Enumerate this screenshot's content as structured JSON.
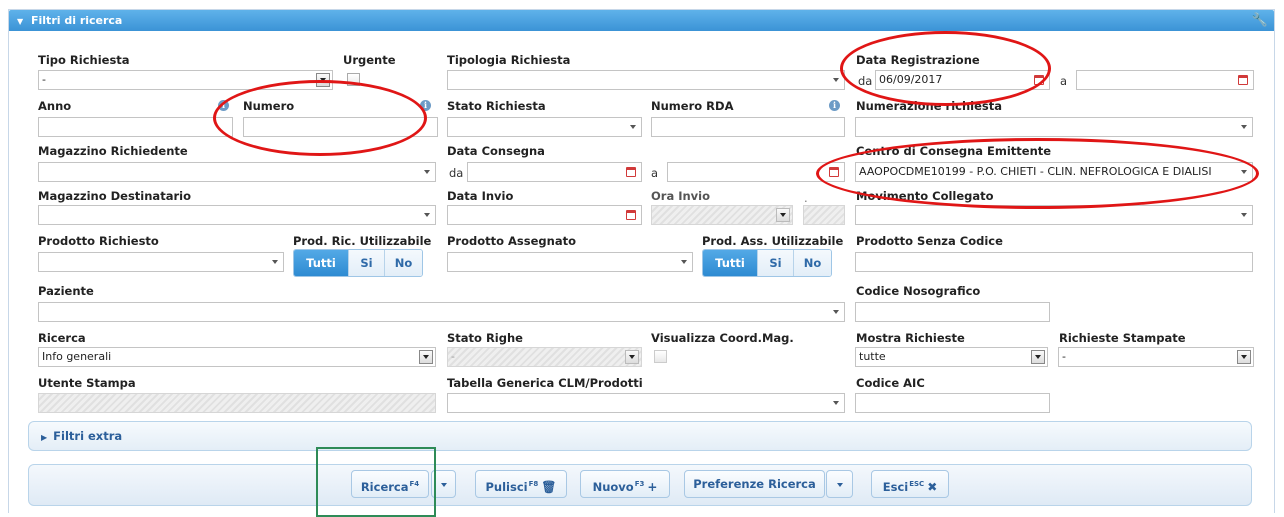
{
  "panel": {
    "title": "Filtri di ricerca"
  },
  "labels": {
    "tipo_richiesta": "Tipo Richiesta",
    "urgente": "Urgente",
    "tipologia_richiesta": "Tipologia Richiesta",
    "data_registrazione": "Data Registrazione",
    "anno": "Anno",
    "numero": "Numero",
    "stato_richiesta": "Stato Richiesta",
    "numero_rda": "Numero RDA",
    "numerazione_richiesta": "Numerazione richiesta",
    "magazzino_richiedente": "Magazzino Richiedente",
    "data_consegna": "Data Consegna",
    "centro_consegna": "Centro di Consegna Emittente",
    "magazzino_destinatario": "Magazzino Destinatario",
    "data_invio": "Data Invio",
    "ora_invio": "Ora Invio",
    "ora_sep": ".",
    "movimento_collegato": "Movimento Collegato",
    "prodotto_richiesto": "Prodotto Richiesto",
    "prod_ric_utilizzabile": "Prod. Ric. Utilizzabile",
    "prodotto_assegnato": "Prodotto Assegnato",
    "prod_ass_utilizzabile": "Prod. Ass. Utilizzabile",
    "prodotto_senza_codice": "Prodotto Senza Codice",
    "paziente": "Paziente",
    "codice_nosografico": "Codice Nosografico",
    "ricerca": "Ricerca",
    "stato_righe": "Stato Righe",
    "visualizza_coord": "Visualizza Coord.Mag.",
    "mostra_richieste": "Mostra Richieste",
    "richieste_stampate": "Richieste Stampate",
    "utente_stampa": "Utente Stampa",
    "tabella_generica": "Tabella Generica CLM/Prodotti",
    "codice_aic": "Codice AIC",
    "da": "da",
    "a": "a"
  },
  "values": {
    "tipo_richiesta": "-",
    "data_registrazione_da": "06/09/2017",
    "centro_consegna": "AAOPOCDME10199 - P.O. CHIETI - CLIN. NEFROLOGICA E DIALISI",
    "ricerca": "Info generali",
    "stato_righe": "-",
    "mostra_richieste": "tutte",
    "richieste_stampate": "-"
  },
  "toggles": {
    "tutti": "Tutti",
    "si": "Si",
    "no": "No"
  },
  "filtri_extra": "Filtri extra",
  "buttons": {
    "ricerca": "Ricerca",
    "ricerca_key": "F4",
    "pulisci": "Pulisci",
    "pulisci_key": "F8",
    "nuovo": "Nuovo",
    "nuovo_key": "F3",
    "preferenze": "Preferenze Ricerca",
    "esci": "Esci",
    "esci_key": "ESC"
  },
  "icons": [
    "chevron-down-icon",
    "wrench-icon",
    "info-icon",
    "calendar-icon",
    "trash-icon",
    "plus-icon",
    "close-icon",
    "chevron-right-icon"
  ],
  "colors": {
    "header": "#3b93d6",
    "annotation_red": "#e01616",
    "annotation_green": "#2e8b57"
  }
}
